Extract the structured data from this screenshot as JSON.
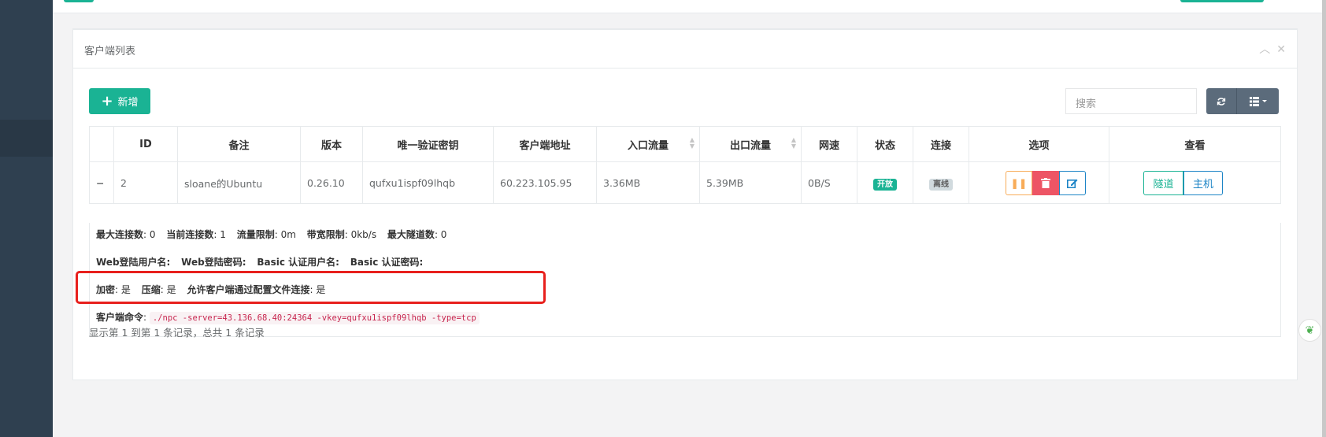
{
  "panel": {
    "title": "客户端列表",
    "tools": {
      "collapse_icon": "chevron-up-icon",
      "close_icon": "close-icon"
    }
  },
  "toolbar": {
    "add_label": "新增",
    "search_placeholder": "搜索",
    "refresh_icon": "refresh-icon",
    "columns_icon": "columns-icon"
  },
  "table": {
    "headers": [
      "",
      "ID",
      "备注",
      "版本",
      "唯一验证密钥",
      "客户端地址",
      "入口流量",
      "出口流量",
      "网速",
      "状态",
      "连接",
      "选项",
      "查看"
    ],
    "row": {
      "expand": "−",
      "id": "2",
      "remark": "sloane的Ubuntu",
      "version": "0.26.10",
      "vkey": "qufxu1ispf09lhqb",
      "address": "60.223.105.95",
      "in_flow": "3.36MB",
      "out_flow": "5.39MB",
      "speed": "0B/S",
      "status": "开放",
      "connect": "离线",
      "view_tunnel": "隧道",
      "view_host": "主机"
    }
  },
  "detail": {
    "line1": [
      {
        "k": "最大连接数",
        "v": "0"
      },
      {
        "k": "当前连接数",
        "v": "1"
      },
      {
        "k": "流量限制",
        "v": "0m"
      },
      {
        "k": "带宽限制",
        "v": "0kb/s"
      },
      {
        "k": "最大隧道数",
        "v": "0"
      }
    ],
    "line2": [
      "Web登陆用户名:",
      "Web登陆密码:",
      "Basic 认证用户名:",
      "Basic 认证密码:"
    ],
    "line3": [
      {
        "k": "加密",
        "v": "是"
      },
      {
        "k": "压缩",
        "v": "是"
      },
      {
        "k": "允许客户端通过配置文件连接",
        "v": "是"
      }
    ],
    "command_label": "客户端命令",
    "command": "./npc -server=43.136.68.40:24364 -vkey=qufxu1ispf09lhqb -type=tcp"
  },
  "pagination_text": "显示第 1 到第 1 条记录，总共 1 条记录",
  "colors": {
    "primary": "#1ab394",
    "info": "#1c84c6",
    "danger": "#ed5565",
    "warning": "#f8ac59",
    "highlight": "#e8201d"
  }
}
